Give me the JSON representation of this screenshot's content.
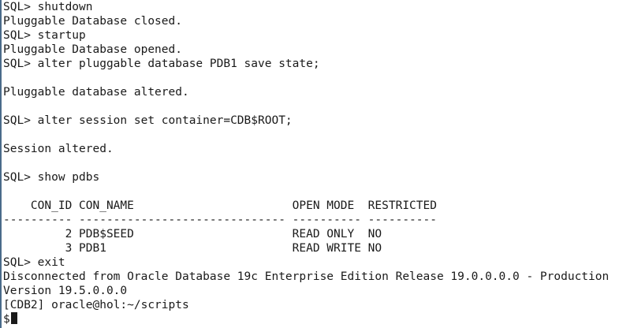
{
  "terminal": {
    "lines": [
      "SQL> shutdown",
      "Pluggable Database closed.",
      "SQL> startup",
      "Pluggable Database opened.",
      "SQL> alter pluggable database PDB1 save state;",
      "",
      "Pluggable database altered.",
      "",
      "SQL> alter session set container=CDB$ROOT;",
      "",
      "Session altered.",
      "",
      "SQL> show pdbs",
      "",
      "    CON_ID CON_NAME                       OPEN MODE  RESTRICTED",
      "---------- ------------------------------ ---------- ----------",
      "         2 PDB$SEED                       READ ONLY  NO",
      "         3 PDB1                           READ WRITE NO",
      "SQL> exit",
      "Disconnected from Oracle Database 19c Enterprise Edition Release 19.0.0.0.0 - Production",
      "Version 19.5.0.0.0",
      "[CDB2] oracle@hol:~/scripts",
      "$"
    ]
  }
}
